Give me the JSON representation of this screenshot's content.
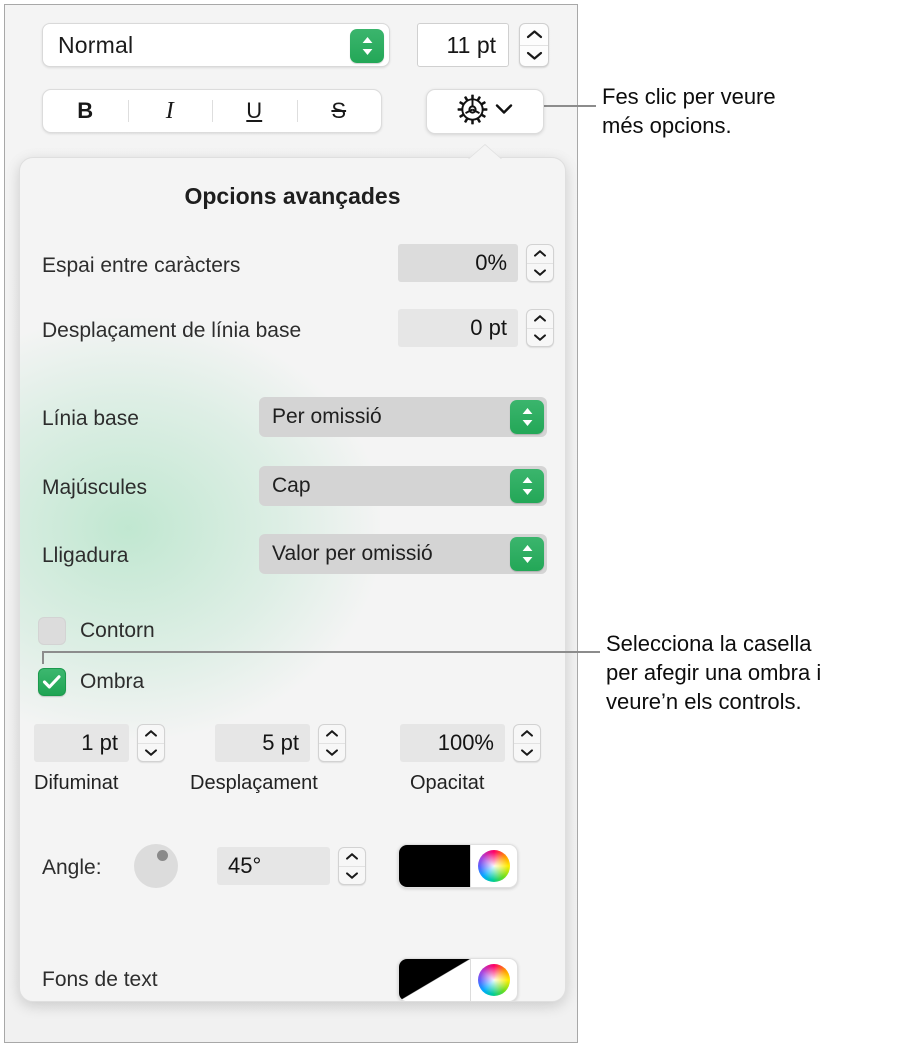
{
  "toolbar": {
    "paragraph_style": {
      "value": "Normal",
      "popup_icon": "up-down-chevrons-icon"
    },
    "font_size": {
      "value": "11 pt",
      "stepper_icon": "stepper-arrows-icon"
    },
    "typography": [
      {
        "name": "bold",
        "label": "B"
      },
      {
        "name": "italic",
        "label": "I"
      },
      {
        "name": "underline",
        "label": "U"
      },
      {
        "name": "strikethrough",
        "label": "S"
      }
    ],
    "more_options_button": {
      "icon": "gear-icon",
      "chevron": "chevron-down-icon"
    }
  },
  "popover": {
    "title": "Opcions avançades",
    "fields": [
      {
        "label": "Espai entre caràcters",
        "value": "0%"
      },
      {
        "label": "Desplaçament de línia base",
        "value": "0 pt"
      }
    ],
    "menus": [
      {
        "label": "Línia base",
        "value": "Per omissió"
      },
      {
        "label": "Majúscules",
        "value": "Cap"
      },
      {
        "label": "Lligadura",
        "value": "Valor per omissió"
      }
    ],
    "checkboxes": [
      {
        "label": "Contorn",
        "checked": false
      },
      {
        "label": "Ombra",
        "checked": true
      }
    ],
    "shadow_controls": [
      {
        "value": "1 pt",
        "label": "Difuminat"
      },
      {
        "value": "5 pt",
        "label": "Desplaçament"
      },
      {
        "value": "100%",
        "label": "Opacitat"
      }
    ],
    "angle": {
      "label": "Angle:",
      "value": "45°",
      "dial_icon": "angle-dial-icon",
      "color": "#000000",
      "color_wheel_icon": "color-wheel-icon"
    },
    "text_background": {
      "label": "Fons de text",
      "swatch": "none-diagonal",
      "color_wheel_icon": "color-wheel-icon"
    }
  },
  "callouts": [
    {
      "name": "more-options-callout",
      "text": "Fes clic per veure\nmés opcions."
    },
    {
      "name": "shadow-checkbox-callout",
      "text": "Selecciona la casella\nper afegir una ombra i\nveure’n els controls."
    }
  ],
  "colors": {
    "accent_green": "#22a755",
    "panel_bg": "#f2f2f2",
    "field_grey": "#dcdcdc",
    "dropdown_grey": "#d4d4d4",
    "leader_line": "#8c8c8c"
  }
}
